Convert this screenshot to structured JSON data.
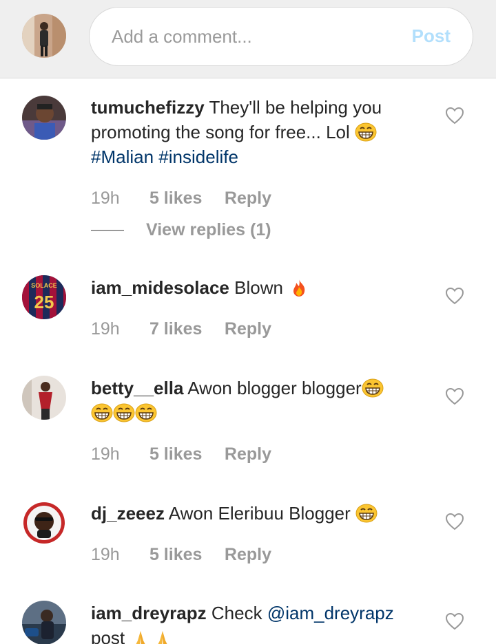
{
  "composer": {
    "placeholder": "Add a comment...",
    "post_label": "Post"
  },
  "comments": [
    {
      "username": "tumuchefizzy",
      "text": "They'll be helping you promoting the song for free... Lol",
      "hashtags": [
        "#Malian",
        "#insidelife"
      ],
      "time": "19h",
      "likes": "5 likes",
      "reply": "Reply",
      "view_replies": "View replies (1)"
    },
    {
      "username": "iam_midesolace",
      "text": "Blown",
      "avatar_text": [
        "SOLACE",
        "25"
      ],
      "time": "19h",
      "likes": "7 likes",
      "reply": "Reply"
    },
    {
      "username": "betty__ella",
      "text": "Awon blogger blogger",
      "time": "19h",
      "likes": "5 likes",
      "reply": "Reply"
    },
    {
      "username": "dj_zeeez",
      "text": "Awon Eleribuu Blogger",
      "time": "19h",
      "likes": "5 likes",
      "reply": "Reply"
    },
    {
      "username": "iam_dreyrapz",
      "text": "Check",
      "mention": "@iam_dreyrapz",
      "text_after": "post"
    }
  ],
  "colors": {
    "link": "#003569",
    "muted": "#999999",
    "post_disabled": "#b2dffc",
    "topbar": "#efefef"
  },
  "icons": [
    "heart-icon",
    "grinning-emoji",
    "fire-emoji",
    "folded-hands-emoji"
  ]
}
